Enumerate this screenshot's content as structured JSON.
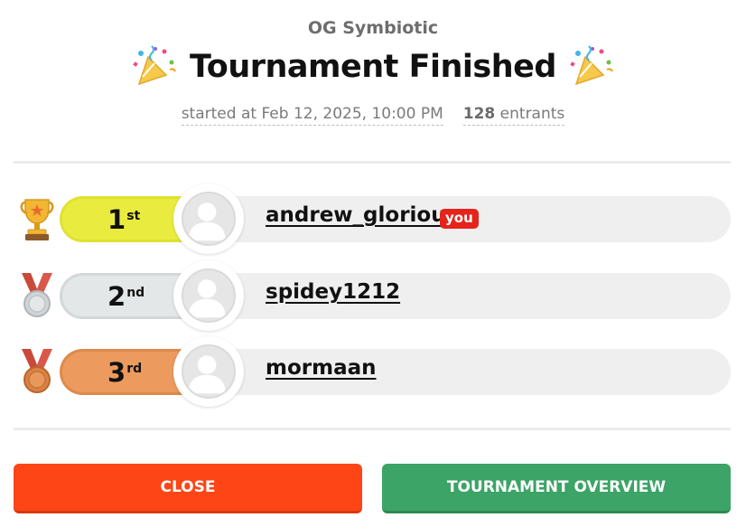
{
  "header": {
    "subtitle": "OG Symbiotic",
    "title": "Tournament Finished",
    "started": "started at Feb 12, 2025, 10:00 PM",
    "entrants_count": "128",
    "entrants_label": "entrants",
    "icons": [
      "party-popper-icon",
      "party-popper-icon"
    ]
  },
  "standings": [
    {
      "place": "1",
      "suffix": "st",
      "username": "andrew_gloriou",
      "badge": "you",
      "medal": "trophy-icon",
      "color": "#e9ec3f",
      "border": "#e0e232"
    },
    {
      "place": "2",
      "suffix": "nd",
      "username": "spidey1212",
      "medal": "silver-medal-icon",
      "color": "#e4e7e8",
      "border": "#d4d8da"
    },
    {
      "place": "3",
      "suffix": "rd",
      "username": "mormaan",
      "medal": "bronze-medal-icon",
      "color": "#ec9a5d",
      "border": "#dd8a4c"
    }
  ],
  "actions": {
    "close_label": "CLOSE",
    "overview_label": "TOURNAMENT OVERVIEW"
  },
  "colors": {
    "close": "#fd4516",
    "overview": "#3ca466",
    "you_badge": "#e5241b"
  }
}
